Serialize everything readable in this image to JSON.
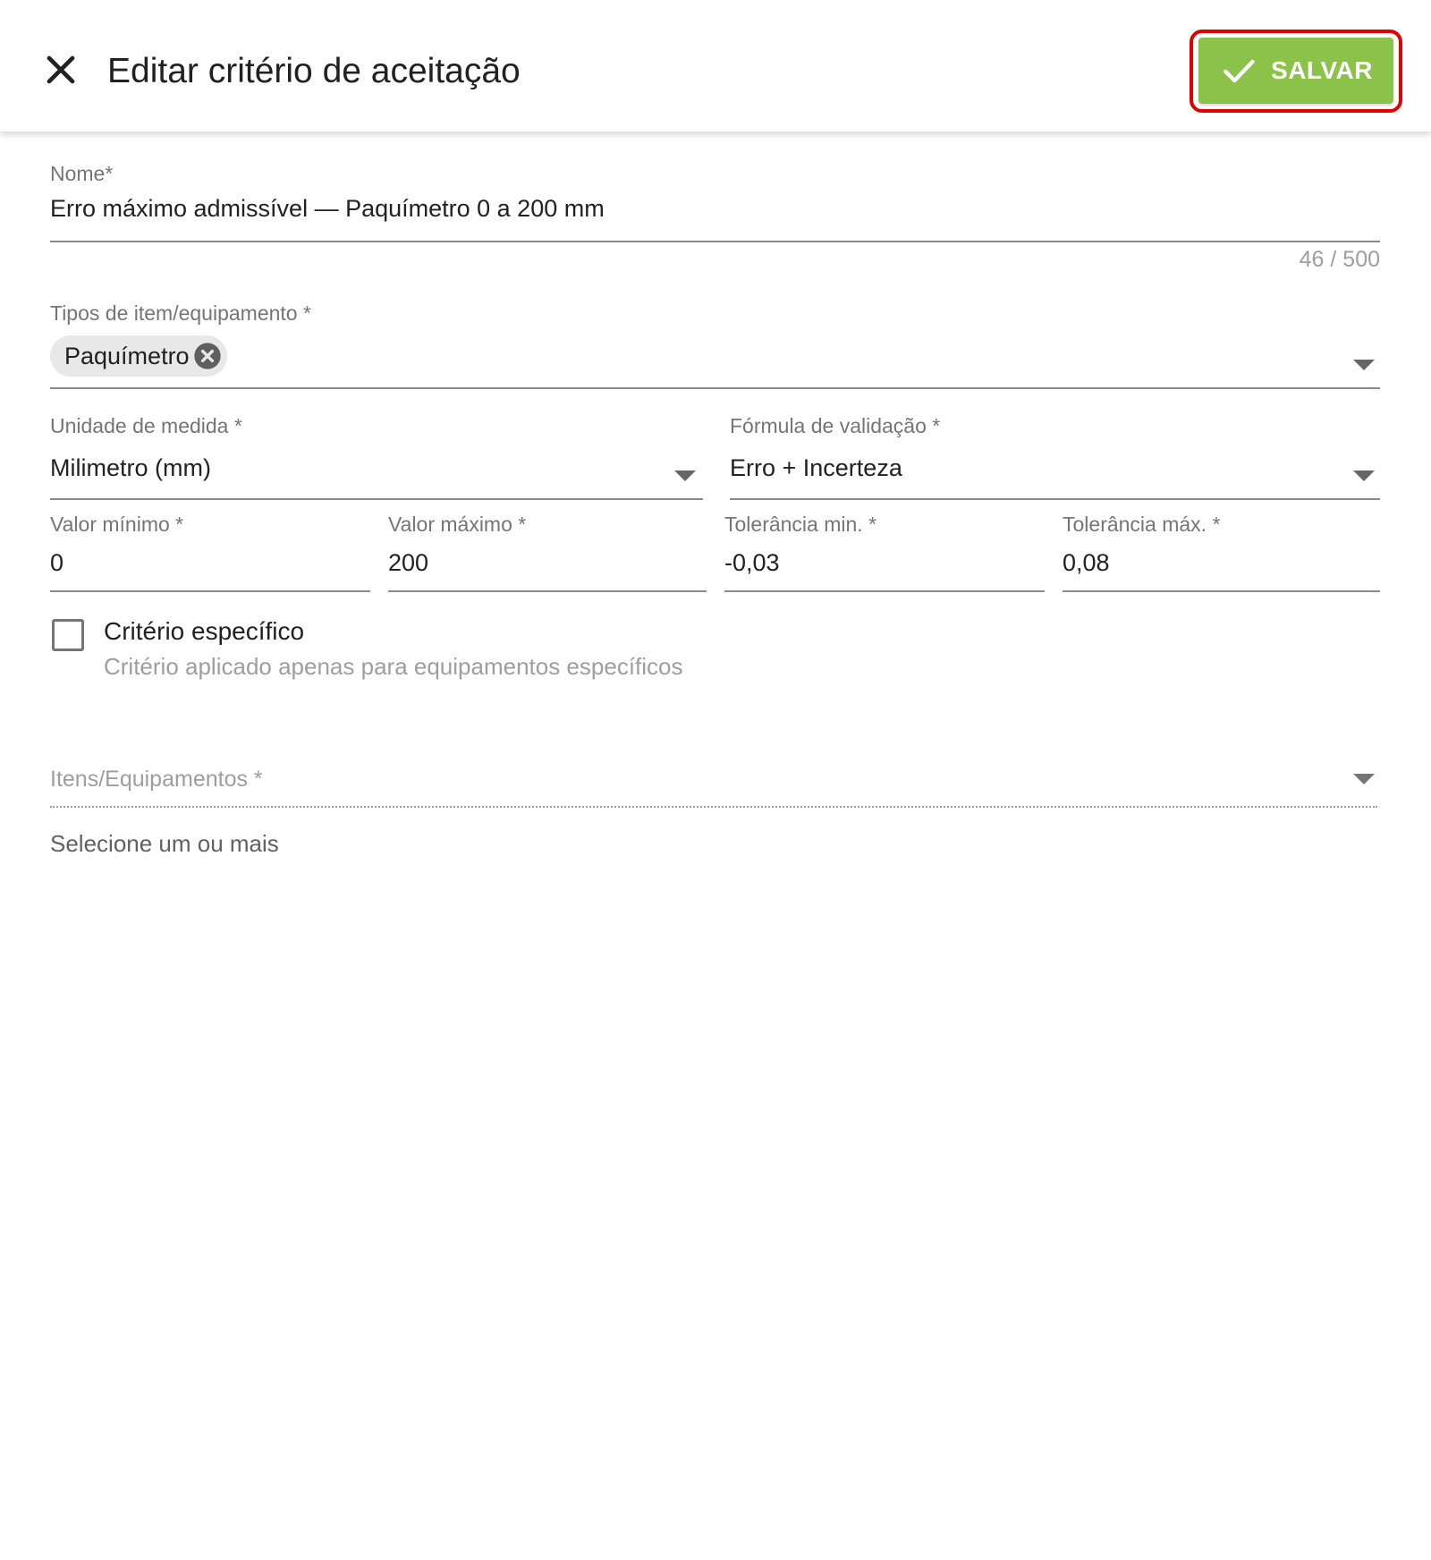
{
  "header": {
    "title": "Editar critério de aceitação",
    "close_icon": "close-icon",
    "save_label": "SALVAR",
    "save_icon": "check-icon",
    "accent_color": "#8bc34a",
    "highlight_color": "#e00000"
  },
  "form": {
    "name": {
      "label": "Nome*",
      "value": "Erro máximo admissível — Paquímetro 0 a 200 mm",
      "counter": "46 / 500"
    },
    "item_types": {
      "label": "Tipos de item/equipamento *",
      "chips": [
        "Paquímetro"
      ]
    },
    "unit": {
      "label": "Unidade de medida *",
      "value": "Milimetro (mm)"
    },
    "formula": {
      "label": "Fórmula de validação *",
      "value": "Erro + Incerteza"
    },
    "min_value": {
      "label": "Valor mínimo *",
      "value": "0"
    },
    "max_value": {
      "label": "Valor máximo *",
      "value": "200"
    },
    "tol_min": {
      "label": "Tolerância min. *",
      "value": "-0,03"
    },
    "tol_max": {
      "label": "Tolerância máx. *",
      "value": "0,08"
    },
    "specific": {
      "label": "Critério específico",
      "help": "Critério aplicado apenas para equipamentos específicos",
      "checked": false
    },
    "items": {
      "label": "Itens/Equipamentos *",
      "hint": "Selecione um ou mais"
    }
  }
}
